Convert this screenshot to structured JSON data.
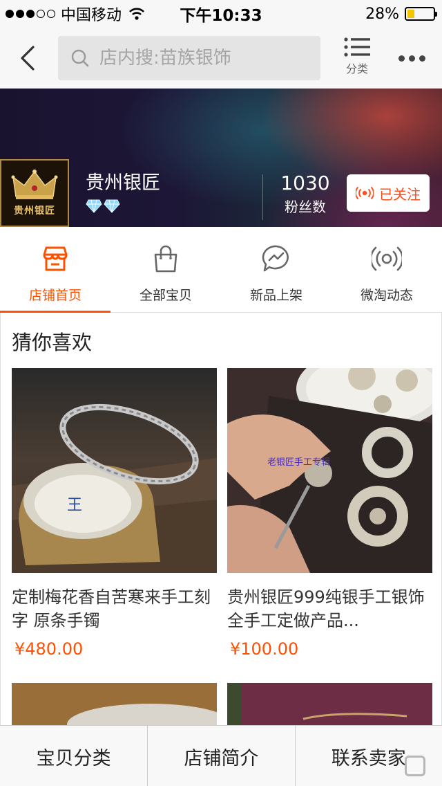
{
  "status_bar": {
    "carrier": "中国移动",
    "time": "下午10:33",
    "battery_percent_text": "28%",
    "battery_level": 0.28,
    "signal_bars_filled": 3,
    "signal_bars_total": 5
  },
  "nav": {
    "search_placeholder": "店内搜:苗族银饰",
    "category_label": "分类",
    "icons": [
      "back-icon",
      "search-icon",
      "list-icon",
      "more-icon"
    ]
  },
  "shop": {
    "name": "贵州银匠",
    "logo_text": "贵州银匠",
    "diamond_count": 2,
    "fans_count": "1030",
    "fans_label": "粉丝数",
    "follow_label": "已关注"
  },
  "tabs": [
    {
      "label": "店铺首页",
      "icon": "store-icon",
      "active": true
    },
    {
      "label": "全部宝贝",
      "icon": "bag-icon",
      "active": false
    },
    {
      "label": "新品上架",
      "icon": "chat-bolt-icon",
      "active": false
    },
    {
      "label": "微淘动态",
      "icon": "broadcast-icon",
      "active": false
    }
  ],
  "section": {
    "title": "猜你喜欢",
    "products": [
      {
        "title": "定制梅花香自苦寒来手工刻字 原条手镯",
        "price": "¥480.00"
      },
      {
        "title": "贵州银匠999纯银手工银饰全手工定做产品...",
        "price": "¥100.00"
      }
    ]
  },
  "bottom_bar": {
    "items": [
      "宝贝分类",
      "店铺简介",
      "联系卖家"
    ]
  },
  "colors": {
    "accent": "#ff5000",
    "follow_text": "#ff4e1a",
    "battery": "#f4c400"
  }
}
